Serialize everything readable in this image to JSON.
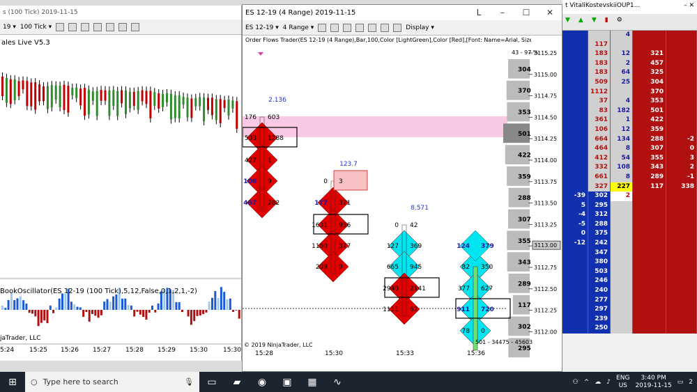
{
  "left": {
    "title": "s (100 Tick)  2019-11-15",
    "toolbar": {
      "tf_short": "19 ▾",
      "tf": "100 Tick ▾"
    },
    "indicator_title": "ales Live V5.3",
    "osc_title": "BookOscillator(ES 12-19 (100 Tick),5,12,False,0,1,2,1,-2)",
    "copyright": "jaTrader, LLC",
    "times": [
      "5:24",
      "15:25",
      "15:26",
      "15:27",
      "15:28",
      "15:29",
      "15:30",
      "15:30"
    ]
  },
  "right": {
    "title": "ES 12-19 (4 Range)  2019-11-15",
    "toolbar": {
      "instrument": "ES 12-19 ▾",
      "range": "4 Range ▾",
      "display": "Display ▾"
    },
    "indicator_label": "Order Flows Trader(ES 12-19 (4 Range),Bar,100,Color [LightGreen],Color [Red],[Font: Name=Arial, Size=9.75 U",
    "corner_note": "43 - 97 %",
    "copyright": "© 2019 NinjaTrader, LLC",
    "summary": "501 - 34475 - 45603",
    "prices": [
      "3115.25",
      "3115.00",
      "3114.75",
      "3114.50",
      "3114.25",
      "3114.00",
      "3113.75",
      "3113.50",
      "3113.25",
      "3113.00",
      "3112.75",
      "3112.50",
      "3112.25",
      "3112.00"
    ],
    "last_price": "3113.00",
    "volume_profile": [
      "304",
      "370",
      "353",
      "501",
      "422",
      "359",
      "288",
      "307",
      "355",
      "343",
      "289",
      "117",
      "302",
      "295"
    ],
    "times": [
      "15:28",
      "15:30",
      "15:33",
      "15:36"
    ],
    "bars": [
      {
        "top_label": "2.136",
        "rows": [
          [
            "176",
            "603"
          ],
          [
            "503",
            "1288"
          ],
          [
            "427",
            "1"
          ],
          [
            "106",
            "9"
          ],
          [
            "467",
            "282"
          ]
        ]
      },
      {
        "top_label": "123.7",
        "rows": [
          [
            "0",
            "3"
          ],
          [
            "177",
            "371"
          ],
          [
            "1631",
            "956"
          ],
          [
            "1160",
            "377"
          ],
          [
            "209",
            "9"
          ]
        ]
      },
      {
        "top_label": "8.571",
        "rows": [
          [
            "0",
            "42"
          ],
          [
            "127",
            "369"
          ],
          [
            "665",
            "945"
          ],
          [
            "2940",
            "2141"
          ],
          [
            "1111",
            "67"
          ]
        ]
      },
      {
        "top_label": "",
        "rows": [
          [
            "124",
            "379"
          ],
          [
            "82",
            "350"
          ],
          [
            "377",
            "627"
          ],
          [
            "911",
            "720"
          ],
          [
            "78",
            "0"
          ]
        ]
      }
    ]
  },
  "dom": {
    "title": "t VitaliKostevskiiOUP1...",
    "rows": [
      [
        "",
        "",
        "4",
        "",
        ""
      ],
      [
        "",
        "117",
        "",
        "",
        ""
      ],
      [
        "",
        "183",
        "12",
        "321",
        ""
      ],
      [
        "",
        "183",
        "2",
        "457",
        ""
      ],
      [
        "",
        "183",
        "64",
        "325",
        ""
      ],
      [
        "",
        "509",
        "25",
        "304",
        ""
      ],
      [
        "",
        "1112",
        "",
        "370",
        ""
      ],
      [
        "",
        "37",
        "4",
        "353",
        ""
      ],
      [
        "",
        "83",
        "182",
        "501",
        ""
      ],
      [
        "",
        "361",
        "1",
        "422",
        ""
      ],
      [
        "",
        "106",
        "12",
        "359",
        ""
      ],
      [
        "",
        "664",
        "134",
        "288",
        "-2"
      ],
      [
        "",
        "464",
        "8",
        "307",
        "0"
      ],
      [
        "",
        "412",
        "54",
        "355",
        "3"
      ],
      [
        "",
        "332",
        "108",
        "343",
        "2"
      ],
      [
        "",
        "661",
        "8",
        "289",
        "-1"
      ],
      [
        "",
        "327",
        "227",
        "117",
        "338"
      ],
      [
        "-39",
        "302",
        "2",
        "",
        ""
      ],
      [
        "5",
        "295",
        "",
        "",
        ""
      ],
      [
        "-4",
        "312",
        "",
        "",
        ""
      ],
      [
        "-5",
        "288",
        "",
        "",
        ""
      ],
      [
        "0",
        "375",
        "",
        "",
        ""
      ],
      [
        "-12",
        "242",
        "",
        "",
        ""
      ],
      [
        "",
        "347",
        "",
        "",
        ""
      ],
      [
        "",
        "380",
        "",
        "",
        ""
      ],
      [
        "",
        "503",
        "",
        "",
        ""
      ],
      [
        "",
        "246",
        "",
        "",
        ""
      ],
      [
        "",
        "240",
        "",
        "",
        ""
      ],
      [
        "",
        "277",
        "",
        "",
        ""
      ],
      [
        "",
        "297",
        "",
        "",
        ""
      ],
      [
        "",
        "239",
        "",
        "",
        ""
      ],
      [
        "",
        "250",
        "",
        "",
        ""
      ]
    ]
  },
  "taskbar": {
    "search_placeholder": "Type here to search",
    "lang": "ENG",
    "region": "US",
    "time": "3:40 PM",
    "date": "2019-11-15",
    "notif": "2"
  }
}
